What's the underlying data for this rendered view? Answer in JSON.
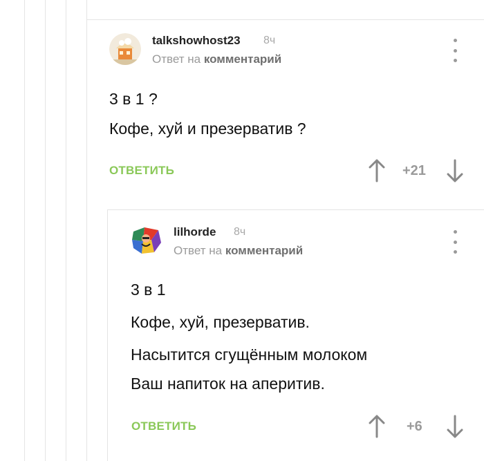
{
  "comments": [
    {
      "username": "talkshowhost23",
      "time": "8ч",
      "reply_prefix": "Ответ на",
      "reply_link": "комментарий",
      "lines": [
        "3 в 1 ?",
        "Кофе, хуй и презерватив ?"
      ],
      "reply_label": "ОТВЕТИТЬ",
      "score": "+21"
    },
    {
      "username": "lilhorde",
      "time": "8ч",
      "reply_prefix": "Ответ на",
      "reply_link": "комментарий",
      "lines": [
        "3 в 1",
        "Кофе, хуй, презерватив.",
        "Насытится сгущённым молоком",
        "Ваш напиток на аперитив."
      ],
      "reply_label": "ОТВЕТИТЬ",
      "score": "+6"
    }
  ],
  "colors": {
    "accent_green": "#8ac858",
    "muted_gray": "#9a9a9a",
    "thread_line": "#e4e4e4"
  },
  "icons": {
    "upvote": "arrow-up-icon",
    "downvote": "arrow-down-icon",
    "menu": "more-vertical-icon"
  }
}
